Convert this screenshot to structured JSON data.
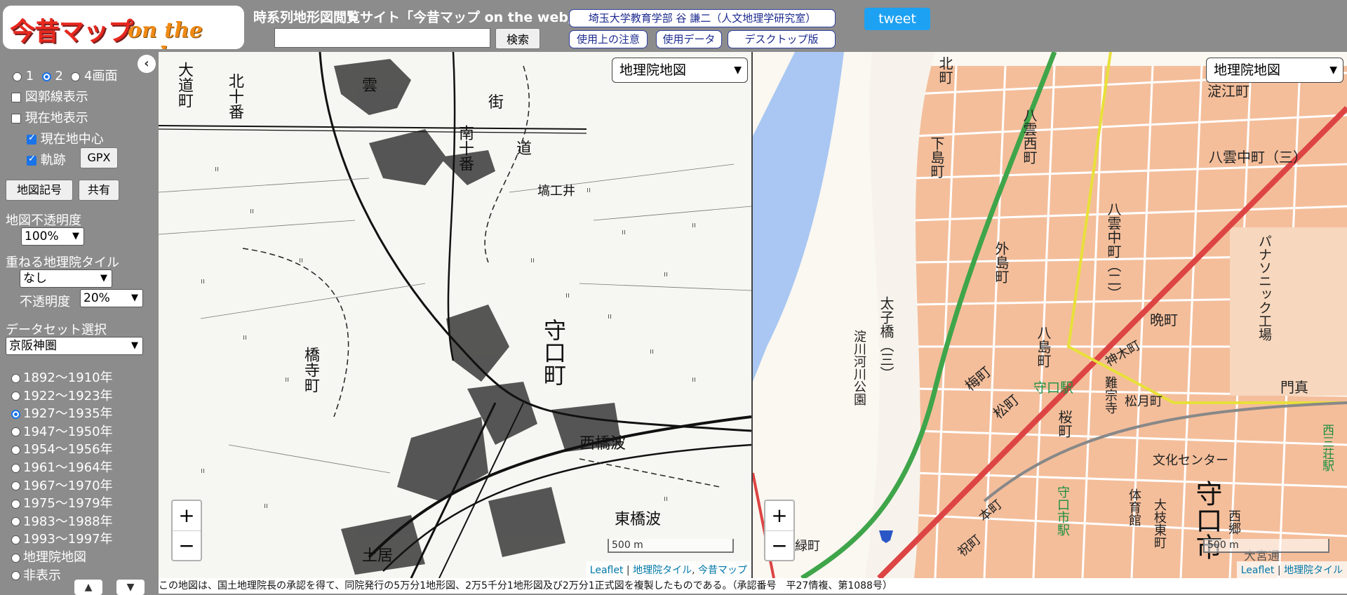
{
  "header": {
    "logo_main": "今昔マップ",
    "logo_sub": "on the web",
    "site_title": "時系列地形図閲覧サイト「今昔マップ on the web」",
    "search_button": "検索",
    "search_value": "",
    "author_link": "埼玉大学教育学部 谷 謙二（人文地理学研究室）",
    "caution_link": "使用上の注意",
    "data_link": "使用データ",
    "desktop_link": "デスクトップ版",
    "tweet_label": "tweet"
  },
  "sidebar": {
    "collapse_icon": "chevron-left-icon",
    "screens": [
      {
        "label": "1",
        "selected": false
      },
      {
        "label": "2",
        "selected": true
      },
      {
        "label": "4画面",
        "selected": false
      }
    ],
    "toggles": [
      {
        "label": "図郭線表示",
        "checked": false
      },
      {
        "label": "現在地表示",
        "checked": false
      },
      {
        "label": "現在地中心",
        "checked": true
      },
      {
        "label": "軌跡",
        "checked": true
      }
    ],
    "gpx_button": "GPX",
    "map_symbols_button": "地図記号",
    "share_button": "共有",
    "opacity_label": "地図不透明度",
    "opacity_value": "100%",
    "overlay_label": "重ねる地理院タイル",
    "overlay_value": "なし",
    "overlay_opacity_label": "不透明度",
    "overlay_opacity_value": "20%",
    "dataset_label": "データセット選択",
    "dataset_value": "京阪神圏",
    "periods": [
      {
        "label": "1892〜1910年",
        "selected": false
      },
      {
        "label": "1922〜1923年",
        "selected": false
      },
      {
        "label": "1927〜1935年",
        "selected": true
      },
      {
        "label": "1947〜1950年",
        "selected": false
      },
      {
        "label": "1954〜1956年",
        "selected": false
      },
      {
        "label": "1961〜1964年",
        "selected": false
      },
      {
        "label": "1967〜1970年",
        "selected": false
      },
      {
        "label": "1975〜1979年",
        "selected": false
      },
      {
        "label": "1983〜1988年",
        "selected": false
      },
      {
        "label": "1993〜1997年",
        "selected": false
      },
      {
        "label": "地理院地図",
        "selected": false
      },
      {
        "label": "非表示",
        "selected": false
      }
    ],
    "up_label": "▲",
    "down_label": "▼"
  },
  "map_left": {
    "layer_select": "地理院地図",
    "zoom_in": "+",
    "zoom_out": "−",
    "scale_label": "500 m",
    "attribution": [
      "Leaflet",
      "地理院タイル",
      "今昔マップ"
    ],
    "place_labels": [
      "大道町",
      "北十番",
      "雲",
      "街",
      "南十番",
      "道",
      "塙工井",
      "守口町",
      "西橋波",
      "橋寺町",
      "東橋波",
      "土居"
    ]
  },
  "map_right": {
    "layer_select": "地理院地図",
    "zoom_in": "+",
    "zoom_out": "−",
    "scale_label": "500 m",
    "attribution": [
      "Leaflet",
      "地理院タイル"
    ],
    "place_labels": [
      "北町",
      "淀江町",
      "八雲西町",
      "八雲中町（三）",
      "下島町",
      "八雲中町（二）",
      "外島町",
      "太子橋（三）",
      "淀川河川公園",
      "八島町",
      "梅町",
      "松町",
      "守口駅",
      "難宗寺",
      "松月町",
      "神木町",
      "晩町",
      "パナソニック工場",
      "門真",
      "桜町",
      "文化センター",
      "守口市駅",
      "本町",
      "体育館",
      "大枝東町",
      "西郷",
      "守口市",
      "緑町",
      "祝町",
      "西三荘駅",
      "大宮通"
    ],
    "colors": {
      "river": "#a9c7f2",
      "block": "#f2b48c",
      "rail": "#dd4444",
      "road_green": "#3fa54a",
      "road_yellow": "#e8e03a"
    }
  },
  "footer": {
    "text": "この地図は、国土地理院長の承認を得て、同院発行の5万分1地形図、2万5千分1地形図及び2万分1正式図を複製したものである。（承認番号　平27情複、第1088号）"
  }
}
